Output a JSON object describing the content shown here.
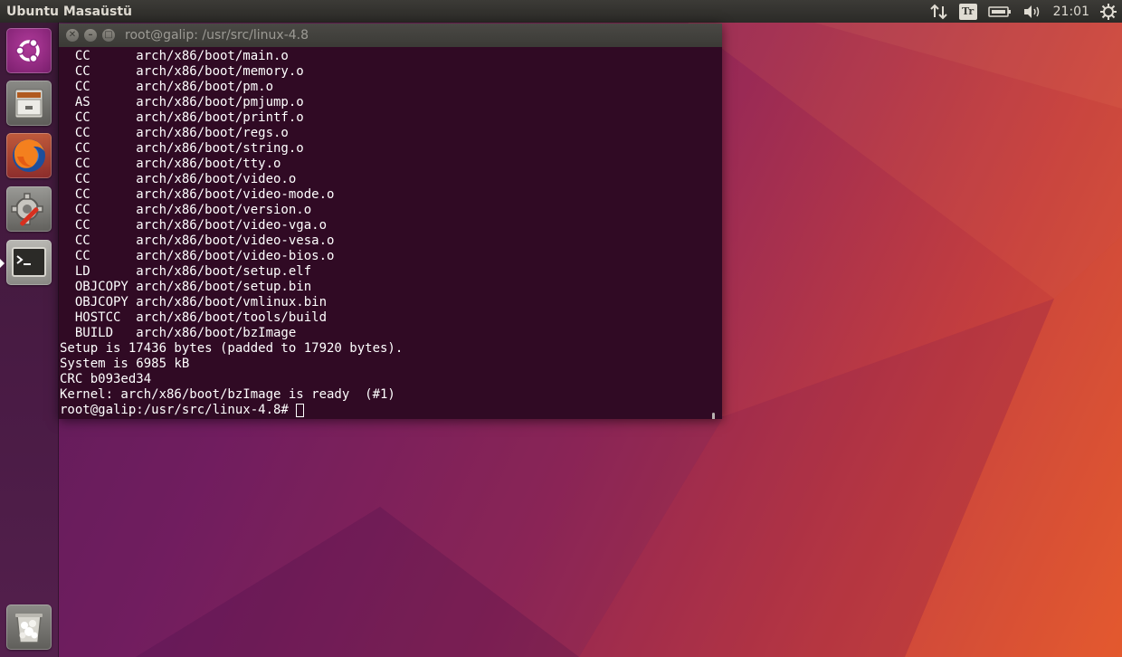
{
  "top_panel": {
    "title": "Ubuntu Masaüstü",
    "keyboard_layout": "Tr",
    "clock": "21:01",
    "icons": [
      "network-arrows-icon",
      "keyboard-layout-icon",
      "battery-icon",
      "volume-icon",
      "gear-icon"
    ]
  },
  "launcher": {
    "items": [
      {
        "name": "ubuntu-dash",
        "icon": "ubuntu-logo-icon"
      },
      {
        "name": "files",
        "icon": "file-cabinet-icon"
      },
      {
        "name": "firefox",
        "icon": "firefox-icon"
      },
      {
        "name": "system-settings",
        "icon": "settings-tools-icon"
      },
      {
        "name": "terminal",
        "icon": "terminal-icon",
        "active": true
      },
      {
        "name": "trash",
        "icon": "trash-icon"
      }
    ]
  },
  "terminal": {
    "title": "root@galip: /usr/src/linux-4.8",
    "lines": [
      "  CC      arch/x86/boot/main.o",
      "  CC      arch/x86/boot/memory.o",
      "  CC      arch/x86/boot/pm.o",
      "  AS      arch/x86/boot/pmjump.o",
      "  CC      arch/x86/boot/printf.o",
      "  CC      arch/x86/boot/regs.o",
      "  CC      arch/x86/boot/string.o",
      "  CC      arch/x86/boot/tty.o",
      "  CC      arch/x86/boot/video.o",
      "  CC      arch/x86/boot/video-mode.o",
      "  CC      arch/x86/boot/version.o",
      "  CC      arch/x86/boot/video-vga.o",
      "  CC      arch/x86/boot/video-vesa.o",
      "  CC      arch/x86/boot/video-bios.o",
      "  LD      arch/x86/boot/setup.elf",
      "  OBJCOPY arch/x86/boot/setup.bin",
      "  OBJCOPY arch/x86/boot/vmlinux.bin",
      "  HOSTCC  arch/x86/boot/tools/build",
      "  BUILD   arch/x86/boot/bzImage",
      "Setup is 17436 bytes (padded to 17920 bytes).",
      "System is 6985 kB",
      "CRC b093ed34",
      "Kernel: arch/x86/boot/bzImage is ready  (#1)"
    ],
    "prompt": "root@galip:/usr/src/linux-4.8#"
  },
  "colors": {
    "terminal_bg": "#300a24",
    "panel_bg": "#3c3b37",
    "launcher_bg": "#4a1b45",
    "accent": "#e95420"
  }
}
